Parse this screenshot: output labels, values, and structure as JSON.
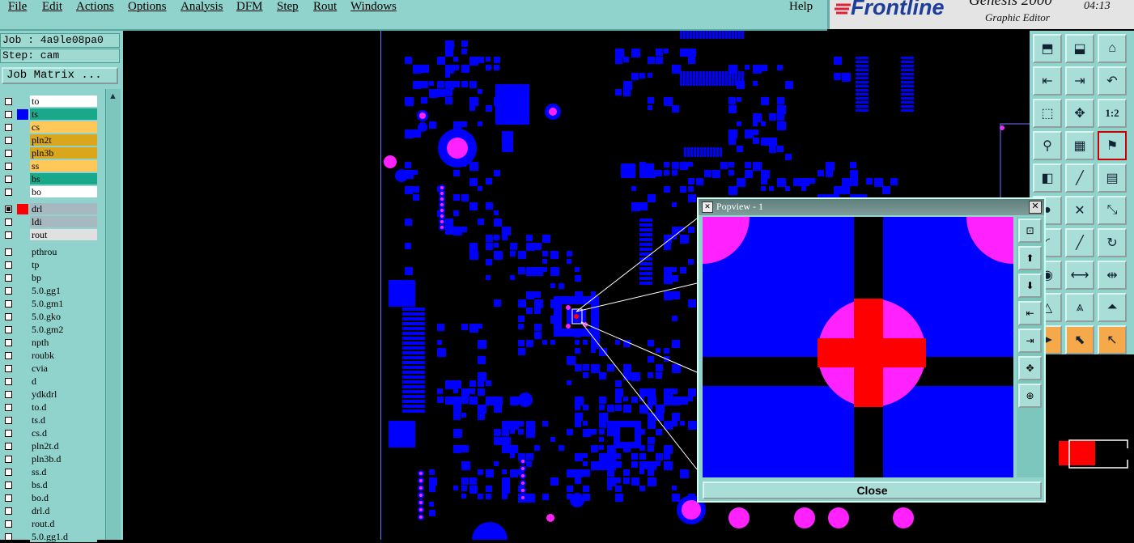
{
  "menubar": {
    "items": [
      "File",
      "Edit",
      "Actions",
      "Options",
      "Analysis",
      "DFM",
      "Step",
      "Rout",
      "Windows"
    ],
    "help": "Help"
  },
  "brand": {
    "logo": "Frontline",
    "product": "Genesis 2000",
    "subtitle": "Graphic Editor",
    "clock": "04:13"
  },
  "job": {
    "job_line": "Job : 4a9le08pa0",
    "step_line": "Step: cam",
    "matrix_button": "Job Matrix ..."
  },
  "layers": [
    {
      "name": "to",
      "bg": "#ffffff",
      "swatch": "",
      "checked": false
    },
    {
      "name": "ts",
      "bg": "#1aa88a",
      "swatch": "#0000ff",
      "checked": false
    },
    {
      "name": "cs",
      "bg": "#ffc858",
      "swatch": "",
      "checked": false
    },
    {
      "name": "pln2t",
      "bg": "#d9a61c",
      "swatch": "",
      "checked": false
    },
    {
      "name": "pln3b",
      "bg": "#d9a61c",
      "swatch": "",
      "checked": false
    },
    {
      "name": "ss",
      "bg": "#ffc858",
      "swatch": "",
      "checked": false
    },
    {
      "name": "bs",
      "bg": "#1aa88a",
      "swatch": "",
      "checked": false
    },
    {
      "name": "bo",
      "bg": "#ffffff",
      "swatch": "",
      "checked": false
    },
    {
      "name": "drl",
      "bg": "#a8b8c0",
      "swatch": "#ff0000",
      "checked": true
    },
    {
      "name": "ldi",
      "bg": "#a8b8c0",
      "swatch": "",
      "checked": false
    },
    {
      "name": "rout",
      "bg": "#e0e0e0",
      "swatch": "",
      "checked": false
    },
    {
      "name": "pthrou",
      "bg": "#8fd3cc",
      "swatch": "",
      "checked": false
    },
    {
      "name": "tp",
      "bg": "#8fd3cc",
      "swatch": "",
      "checked": false
    },
    {
      "name": "bp",
      "bg": "#8fd3cc",
      "swatch": "",
      "checked": false
    },
    {
      "name": "5.0.gg1",
      "bg": "#8fd3cc",
      "swatch": "",
      "checked": false
    },
    {
      "name": "5.0.gm1",
      "bg": "#8fd3cc",
      "swatch": "",
      "checked": false
    },
    {
      "name": "5.0.gko",
      "bg": "#8fd3cc",
      "swatch": "",
      "checked": false
    },
    {
      "name": "5.0.gm2",
      "bg": "#8fd3cc",
      "swatch": "",
      "checked": false
    },
    {
      "name": "npth",
      "bg": "#8fd3cc",
      "swatch": "",
      "checked": false
    },
    {
      "name": "roubk",
      "bg": "#8fd3cc",
      "swatch": "",
      "checked": false
    },
    {
      "name": "cvia",
      "bg": "#8fd3cc",
      "swatch": "",
      "checked": false
    },
    {
      "name": "d",
      "bg": "#8fd3cc",
      "swatch": "",
      "checked": false
    },
    {
      "name": "ydkdrl",
      "bg": "#8fd3cc",
      "swatch": "",
      "checked": false
    },
    {
      "name": "to.d",
      "bg": "#8fd3cc",
      "swatch": "",
      "checked": false
    },
    {
      "name": "ts.d",
      "bg": "#8fd3cc",
      "swatch": "",
      "checked": false
    },
    {
      "name": "cs.d",
      "bg": "#8fd3cc",
      "swatch": "",
      "checked": false
    },
    {
      "name": "pln2t.d",
      "bg": "#8fd3cc",
      "swatch": "",
      "checked": false
    },
    {
      "name": "pln3b.d",
      "bg": "#8fd3cc",
      "swatch": "",
      "checked": false
    },
    {
      "name": "ss.d",
      "bg": "#8fd3cc",
      "swatch": "",
      "checked": false
    },
    {
      "name": "bs.d",
      "bg": "#8fd3cc",
      "swatch": "",
      "checked": false
    },
    {
      "name": "bo.d",
      "bg": "#8fd3cc",
      "swatch": "",
      "checked": false
    },
    {
      "name": "drl.d",
      "bg": "#8fd3cc",
      "swatch": "",
      "checked": false
    },
    {
      "name": "rout.d",
      "bg": "#8fd3cc",
      "swatch": "",
      "checked": false
    },
    {
      "name": "5.0.gg1.d",
      "bg": "#8fd3cc",
      "swatch": "",
      "checked": false
    }
  ],
  "tools": [
    "layer-up-icon",
    "layer-down-icon",
    "home-icon",
    "pan-left-icon",
    "pan-right-icon",
    "undo-zoom-icon",
    "fit-icon",
    "center-icon",
    "ratio-icon",
    "measure-icon",
    "grid-icon",
    "snap-icon",
    "select-icon",
    "line-icon",
    "ruler-icon",
    "pad-icon",
    "cross-icon",
    "connect-icon",
    "arc-icon",
    "diagonal-icon",
    "rotate-icon",
    "pad-red-icon",
    "edge-icon",
    "resize-icon",
    "triangle-icon",
    "triangle-up-icon",
    "triangle-line-icon",
    "pointer-icon",
    "pointer-box-icon",
    "pointer-circle-icon"
  ],
  "tool_labels": {
    "ratio": "1:2"
  },
  "popview": {
    "title": "Popview - 1",
    "close_label": "Close",
    "side_buttons": [
      "zoom-window-icon",
      "raise-icon",
      "lower-icon",
      "left-icon",
      "right-icon",
      "fit-all-icon",
      "center-all-icon"
    ]
  },
  "colors": {
    "pad_blue": "#0000ff",
    "drill_magenta": "#ff22ff",
    "drill_red": "#ff0000",
    "ui_teal": "#8fd3cc"
  }
}
